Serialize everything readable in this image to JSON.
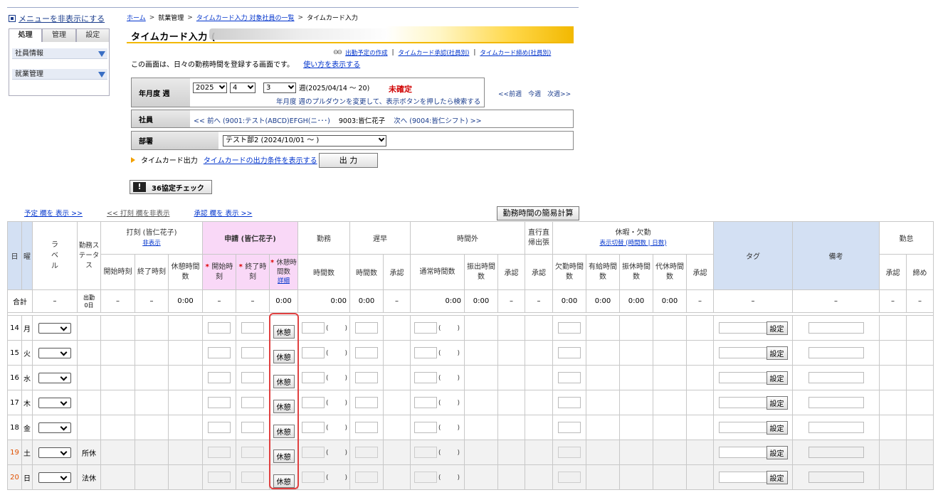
{
  "sidebar": {
    "toggle_label": "メニューを非表示にする",
    "tabs": [
      "処理",
      "管理",
      "設定"
    ],
    "items": [
      "社員情報",
      "就業管理"
    ]
  },
  "breadcrumb": [
    "ホーム",
    "就業管理",
    "タイムカード入力 対象社員の一覧",
    "タイムカード入力"
  ],
  "title": "タイムカード入力 (",
  "links": [
    "出勤予定の作成",
    "タイムカード承認(社員別)",
    "タイムカード締め(社員別)"
  ],
  "intro": {
    "text": "この画面は、日々の勤務時間を登録する画面です。",
    "link": "使い方を表示する"
  },
  "period": {
    "label": "年月度 週",
    "year": "2025",
    "month": "4",
    "week": "3",
    "week_suffix": "週(2025/04/14 ～ 20)",
    "status": "未確定",
    "hint": "年月度 週のプルダウンを変更して、表示ボタンを押したら検索する",
    "nav": [
      "<<前週",
      "今週",
      "次週>>"
    ]
  },
  "employee": {
    "label": "社員",
    "prev": "<< 前へ (9001:テスト(ABCD)EFGH(ニ･･･)",
    "current": "9003:皆仁花子",
    "next": "次へ (9004:皆仁シフト) >>"
  },
  "department": {
    "label": "部署",
    "value": "テスト部2 (2024/10/01 ～ )"
  },
  "output": {
    "label": "タイムカード出力",
    "link": "タイムカードの出力条件を表示する",
    "button": "出 力"
  },
  "check36": {
    "icon": "!",
    "label": "36協定チェック"
  },
  "toggles": [
    "予定 欄を 表示 >>",
    "<< 打刻 欄を非表示",
    "承認 欄を 表示 >>"
  ],
  "calc_button": "勤務時間の簡易計算",
  "table": {
    "h_day": "日",
    "h_dow": "曜",
    "h_label": "ラベル",
    "h_status": "勤務ステータス",
    "h_punch": "打刻 (皆仁花子)",
    "h_punch_link": "非表示",
    "h_punch_cols": [
      "開始時刻",
      "終了時刻",
      "休憩時間数"
    ],
    "h_apply": "申請 (皆仁花子)",
    "h_apply_cols": [
      "開始時刻",
      "終了時刻",
      "休憩時間数"
    ],
    "h_apply_detail": "詳細",
    "h_work": "勤務",
    "h_work_col": "時間数",
    "h_late": "遅早",
    "h_late_cols": [
      "時間数",
      "承認"
    ],
    "h_ot": "時間外",
    "h_ot_cols": [
      "通常時間数",
      "振出時間数",
      "承認"
    ],
    "h_direct": "直行直帰出張",
    "h_direct_col": "承認",
    "h_leave": "休暇・欠勤",
    "h_leave_link": "表示切替 (時間数 | 日数)",
    "h_leave_cols": [
      "欠勤時間数",
      "有給時間数",
      "振休時間数",
      "代休時間数",
      "承認"
    ],
    "h_tag": "タグ",
    "h_note": "備考",
    "h_close": "勤怠",
    "h_close_cols": [
      "承認",
      "締め"
    ],
    "sum": {
      "label": "合計",
      "status_line1": "出勤",
      "status_line2": "0日",
      "dash": "–",
      "zero": "0:00"
    },
    "break_button": "休憩",
    "set_button": "設定",
    "paren_open": "(",
    "paren_close": ")",
    "rows": [
      {
        "day": "14",
        "dow": "月",
        "status": "",
        "weekend": false
      },
      {
        "day": "15",
        "dow": "火",
        "status": "",
        "weekend": false
      },
      {
        "day": "16",
        "dow": "水",
        "status": "",
        "weekend": false
      },
      {
        "day": "17",
        "dow": "木",
        "status": "",
        "weekend": false
      },
      {
        "day": "18",
        "dow": "金",
        "status": "",
        "weekend": false
      },
      {
        "day": "19",
        "dow": "土",
        "status": "所休",
        "weekend": true
      },
      {
        "day": "20",
        "dow": "日",
        "status": "法休",
        "weekend": true
      }
    ]
  }
}
